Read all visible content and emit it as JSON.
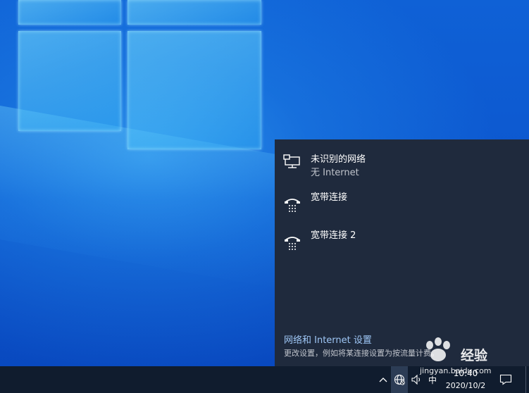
{
  "desktop": {
    "wallpaper": "windows-10-hero",
    "accent_color": "#0c57cf"
  },
  "network_flyout": {
    "background_color": "#1f2a3d",
    "networks": [
      {
        "name": "未识别的网络",
        "status": "无 Internet",
        "icon": "ethernet-icon"
      },
      {
        "name": "宽带连接",
        "icon": "dialup-icon"
      },
      {
        "name": "宽带连接 2",
        "icon": "dialup-icon"
      }
    ],
    "settings_link": "网络和 Internet 设置",
    "settings_description": "更改设置，例如将某连接设置为按流量计费。"
  },
  "taskbar": {
    "tray_icons": [
      "chevron-up-icon",
      "globe-network-icon",
      "volume-icon",
      "ime-icon"
    ],
    "ime_label": "中",
    "clock_time": "10:40",
    "clock_date": "2020/10/2",
    "notification_icon": "action-center-icon"
  },
  "watermark": {
    "text": "经验",
    "url": "jingyan.baidu.com"
  }
}
